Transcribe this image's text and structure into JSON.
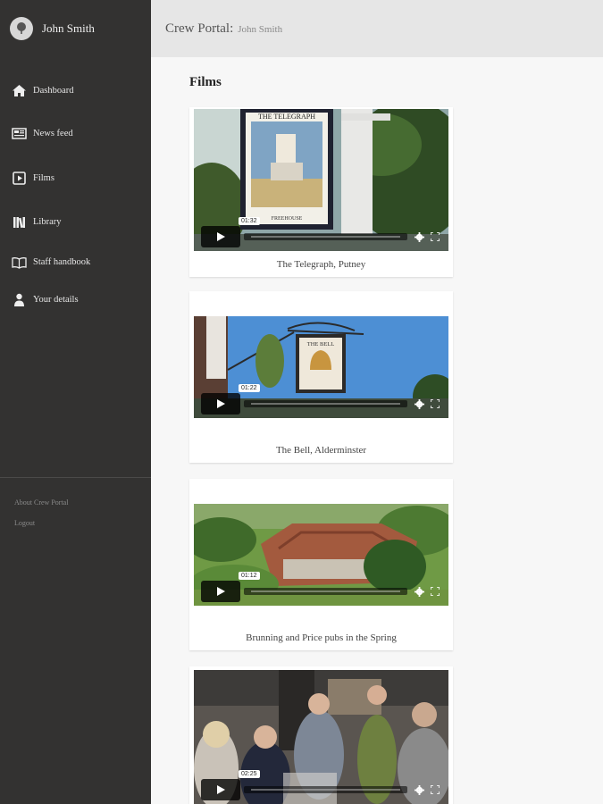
{
  "sidebar": {
    "profile": {
      "name": "John Smith",
      "avatar_icon": "tree-icon"
    },
    "items": [
      {
        "label": "Dashboard",
        "icon": "home-icon"
      },
      {
        "label": "News feed",
        "icon": "newspaper-icon"
      },
      {
        "label": "Films",
        "icon": "film-icon"
      },
      {
        "label": "Library",
        "icon": "books-icon"
      },
      {
        "label": "Staff handbook",
        "icon": "open-book-icon"
      },
      {
        "label": "Your details",
        "icon": "person-icon"
      }
    ],
    "footer": {
      "about": "About Crew Portal",
      "logout": "Logout"
    }
  },
  "header": {
    "title": "Crew Portal:",
    "user": "John Smith"
  },
  "main": {
    "title": "Films",
    "films": [
      {
        "caption": "The Telegraph, Putney",
        "duration": "01:32",
        "sign_text": "THE TELEGRAPH",
        "sign_sub": "FREEHOUSE"
      },
      {
        "caption": "The Bell, Alderminster",
        "duration": "01:22",
        "sign_text": "THE BELL"
      },
      {
        "caption": "Brunning and Price pubs in the Spring",
        "duration": "01:12"
      },
      {
        "caption": "",
        "duration": "02:25"
      }
    ]
  },
  "colors": {
    "sidebar_bg": "#333231",
    "header_bg": "#e6e6e6",
    "main_bg": "#f7f7f7"
  }
}
